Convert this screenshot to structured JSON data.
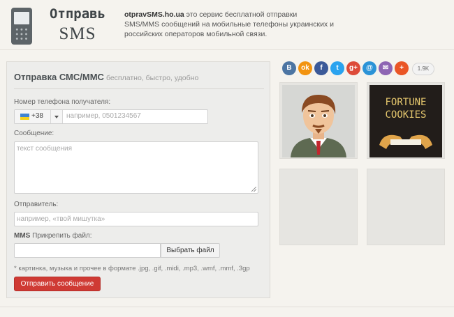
{
  "header": {
    "logo_line1": "Отправь",
    "logo_line2": "SMS",
    "site": "otpravSMS.ho.ua",
    "tagline": " это сервис бесплатной отправки SMS/MMS сообщений на мобильные телефоны украинских и российских операторов мобильной связи."
  },
  "form": {
    "title": "Отправка СМС/ММС",
    "subtitle": "бесплатно, быстро, удобно",
    "phone_label": "Номер телефона получателя:",
    "country_code": "+38",
    "phone_placeholder": "например, 0501234567",
    "message_label": "Сообщение:",
    "message_placeholder": "текст сообщения",
    "sender_label": "Отправитель:",
    "sender_placeholder": "например, «твой мишутка»",
    "mms_label_bold": "MMS",
    "mms_label_rest": " Прикрепить файл:",
    "file_button": "Выбрать файл",
    "note": "* картинка, музыка и прочее в формате .jpg, .gif, .midi, .mp3, .wmf, .mmf, .3gp",
    "send_button": "Отправить сообщение"
  },
  "social": {
    "icons": [
      {
        "name": "vk-icon",
        "glyph": "B",
        "color": "#4c75a3"
      },
      {
        "name": "odnoklassniki-icon",
        "glyph": "ok",
        "color": "#f2930f"
      },
      {
        "name": "facebook-icon",
        "glyph": "f",
        "color": "#3b5998"
      },
      {
        "name": "twitter-icon",
        "glyph": "t",
        "color": "#2aa3ef"
      },
      {
        "name": "google-plus-icon",
        "glyph": "g+",
        "color": "#dd4b39"
      },
      {
        "name": "mail-ru-icon",
        "glyph": "@",
        "color": "#2b93d7"
      },
      {
        "name": "email-icon",
        "glyph": "✉",
        "color": "#8e65b3"
      },
      {
        "name": "add-icon",
        "glyph": "+",
        "color": "#ea5626"
      }
    ],
    "count": "1.9K"
  },
  "thumbs": {
    "fortune_line1": "FORTUNE",
    "fortune_line2": "COOKIES"
  },
  "colors": {
    "accent_red": "#cf3a34",
    "page_bg": "#f5f3ee"
  }
}
